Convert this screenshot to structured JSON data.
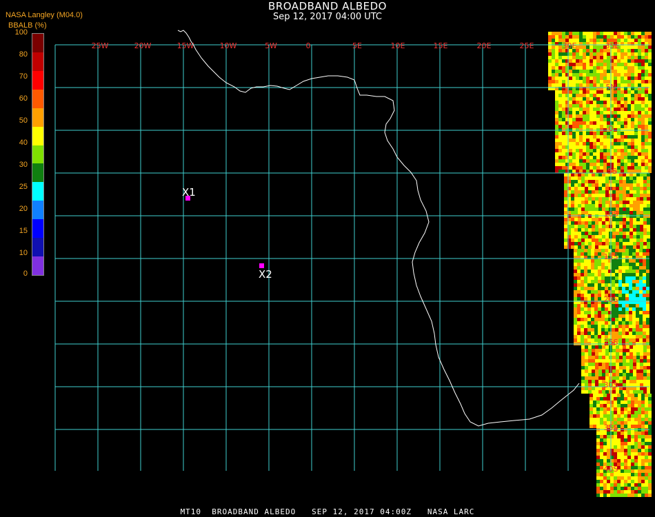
{
  "title": "BROADBAND ALBEDO",
  "subtitle": "Sep 12, 2017 04:00 UTC",
  "source_label": "NASA Langley (M04.0)",
  "units_label": "BBALB (%)",
  "footer": "MT10  BROADBAND ALBEDO   SEP 12, 2017 04:00Z   NASA LARC",
  "legend": {
    "ticks": [
      "100",
      "80",
      "70",
      "60",
      "50",
      "40",
      "30",
      "25",
      "20",
      "15",
      "10",
      "0"
    ],
    "colors": [
      "#7a0000",
      "#c00000",
      "#ff0000",
      "#ff5a00",
      "#ffa000",
      "#ffff00",
      "#80e000",
      "#108010",
      "#00ffff",
      "#1080ff",
      "#0000ff",
      "#1010b0",
      "#8030e0"
    ]
  },
  "grid": {
    "lon_labels": [
      "25W",
      "20W",
      "15W",
      "10W",
      "5W",
      "0",
      "5E",
      "10E",
      "15E",
      "20E",
      "25E",
      "30E",
      "35E"
    ],
    "lat_labels": [
      "5N",
      "0",
      "5S",
      "10S",
      "15S",
      "20S",
      "25S",
      "30S",
      "35S",
      "40S"
    ],
    "line_color": "#40d0d0",
    "label_color": "#ee3333"
  },
  "markers": [
    {
      "id": "X1",
      "label": "X1",
      "color": "#ff00ff"
    },
    {
      "id": "X2",
      "label": "X2",
      "color": "#ff00ff"
    }
  ],
  "coastline_color": "#ffffff"
}
